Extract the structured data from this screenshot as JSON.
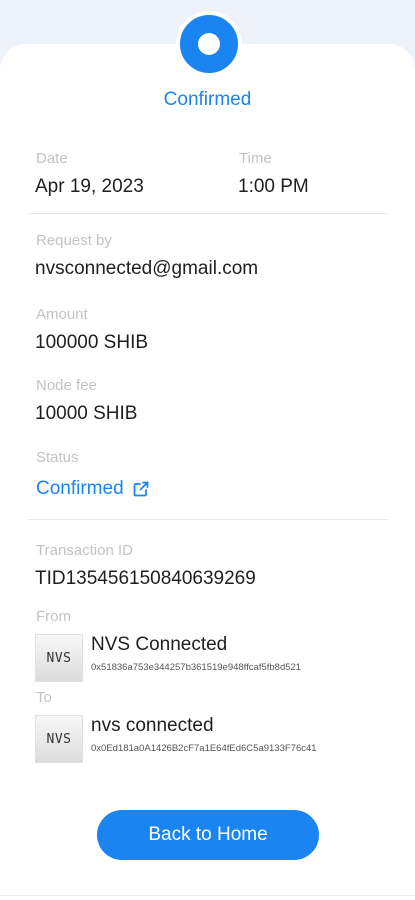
{
  "header": {
    "status": "Confirmed"
  },
  "details": {
    "date_label": "Date",
    "date_value": "Apr 19, 2023",
    "time_label": "Time",
    "time_value": "1:00 PM",
    "request_label": "Request by",
    "request_value": "nvsconnected@gmail.com",
    "amount_label": "Amount",
    "amount_value": "100000 SHIB",
    "fee_label": "Node fee",
    "fee_value": "10000 SHIB",
    "status_label": "Status",
    "status_value": "Confirmed",
    "txid_label": "Transaction ID",
    "txid_value": "TID135456150840639269"
  },
  "from": {
    "label": "From",
    "logo_text": "NVS",
    "name": "NVS Connected",
    "address": "0x51836a753e344257b361519e948ffcaf5fb8d521"
  },
  "to": {
    "label": "To",
    "logo_text": "NVS",
    "name": "nvs connected",
    "address": "0x0Ed181a0A1426B2cF7a1E64fEd6C5a9133F76c41"
  },
  "actions": {
    "home_label": "Back to Home"
  },
  "icons": {
    "status": "circle-status-icon",
    "external": "external-link-icon"
  },
  "colors": {
    "accent": "#1a84f0",
    "label": "#c3c3c3",
    "text": "#1f1f1f"
  }
}
